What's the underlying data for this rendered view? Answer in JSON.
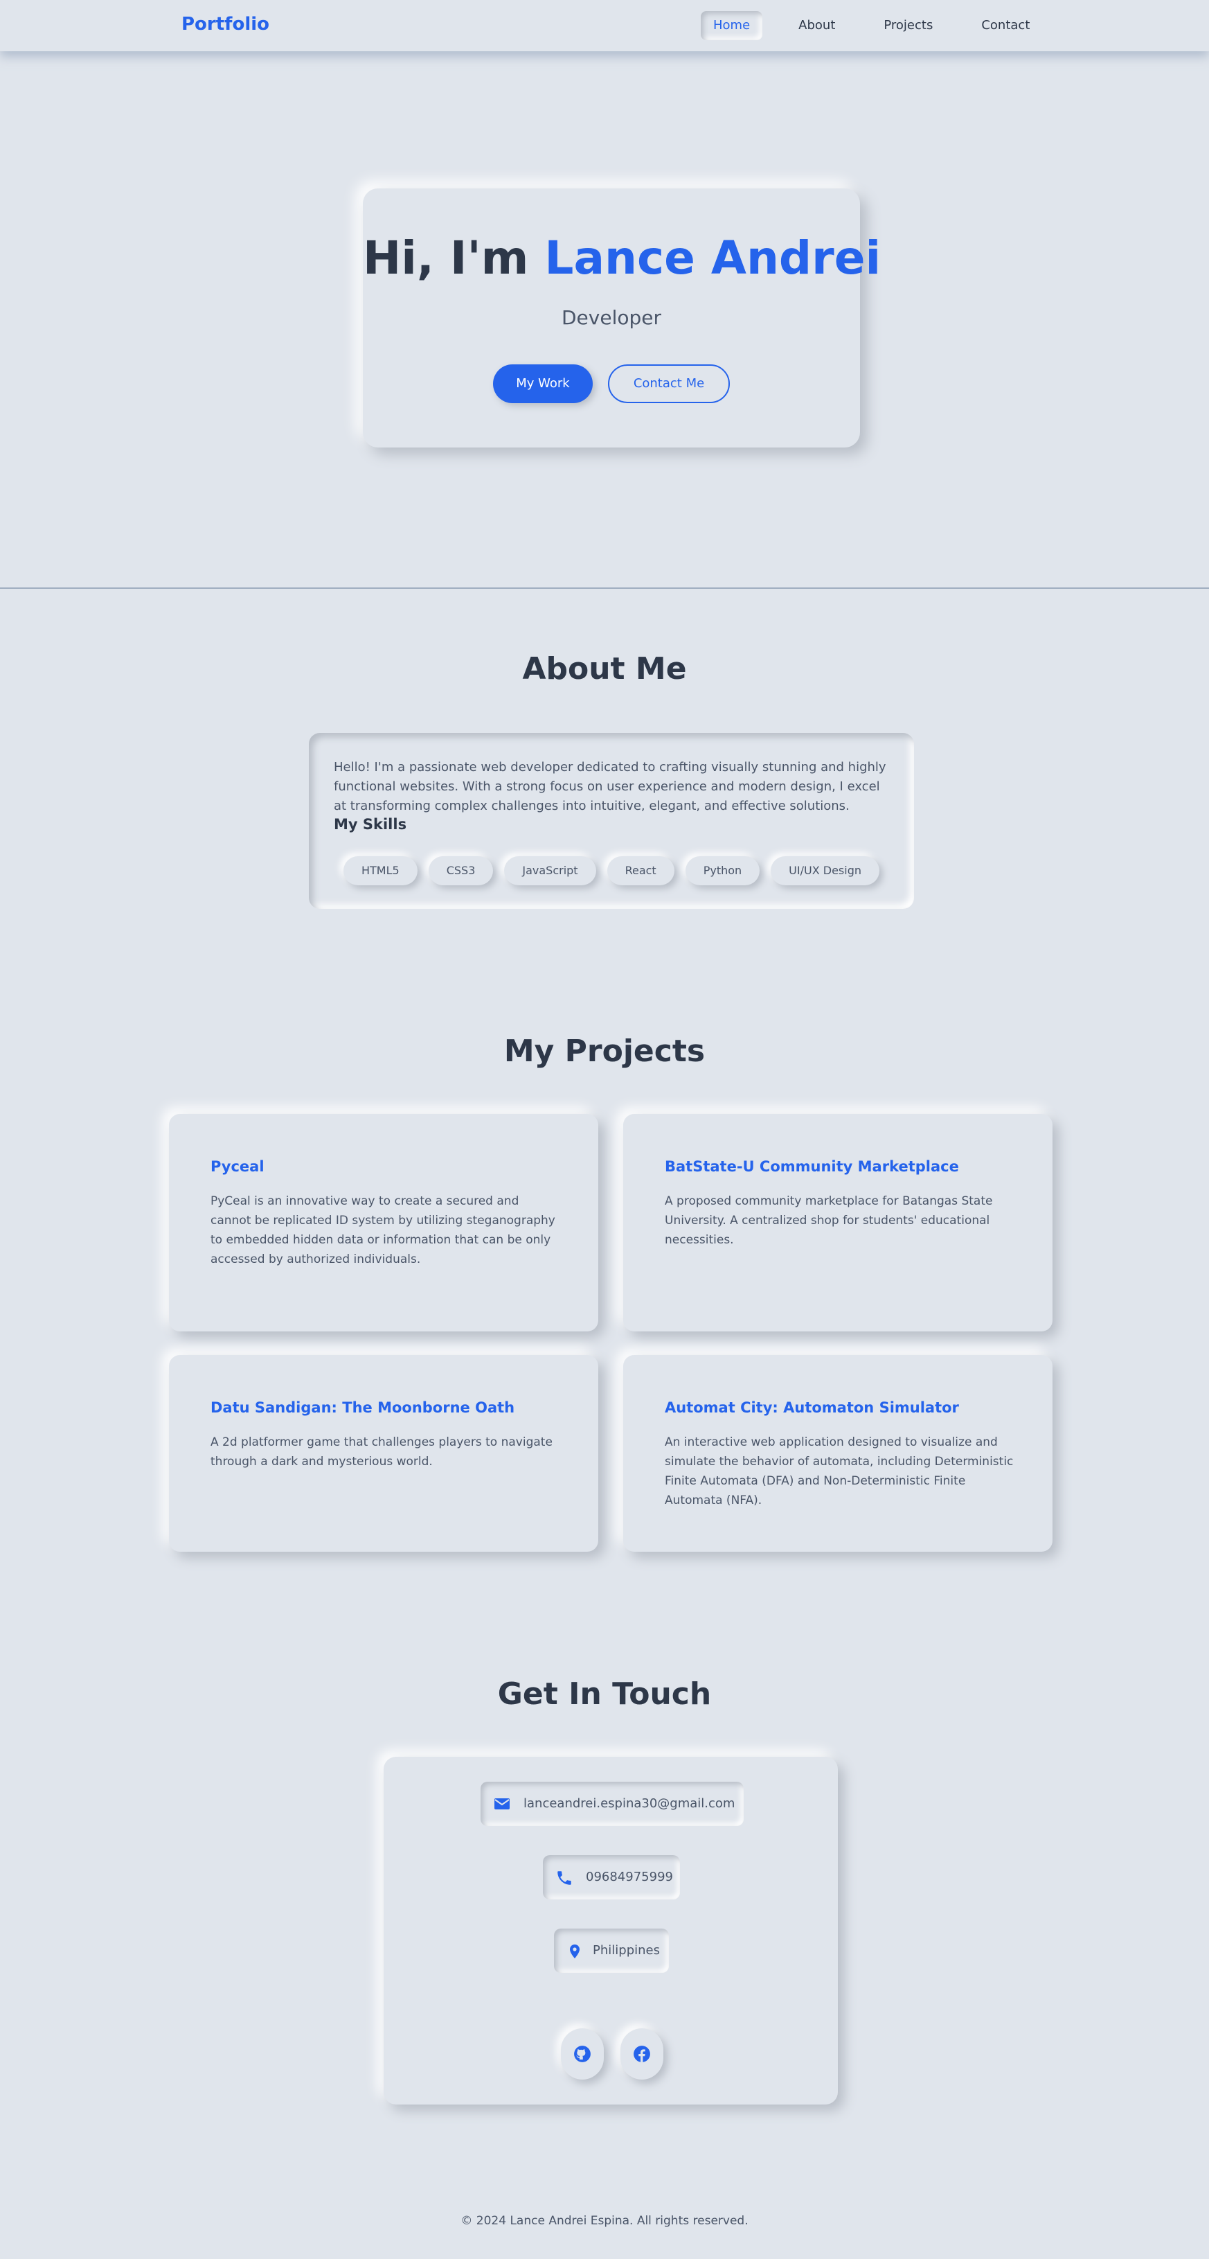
{
  "nav": {
    "logo": "Portfolio",
    "links": [
      {
        "label": "Home",
        "active": true
      },
      {
        "label": "About",
        "active": false
      },
      {
        "label": "Projects",
        "active": false
      },
      {
        "label": "Contact",
        "active": false
      }
    ]
  },
  "hero": {
    "greeting": "Hi, I'm ",
    "name": "Lance Andrei",
    "subtitle": "Developer",
    "primary_button": "My Work",
    "secondary_button": "Contact Me"
  },
  "about": {
    "title": "About Me",
    "text": "Hello! I'm a passionate web developer dedicated to crafting visually stunning and highly functional websites. With a strong focus on user experience and modern design, I excel at transforming complex challenges into intuitive, elegant, and effective solutions.",
    "skills_title": "My Skills",
    "skills": [
      "HTML5",
      "CSS3",
      "JavaScript",
      "React",
      "Python",
      "UI/UX Design"
    ]
  },
  "projects": {
    "title": "My Projects",
    "items": [
      {
        "title": "Pyceal",
        "description": "PyCeal is an innovative way to create a secured and cannot be replicated ID system by utilizing steganography to embedded hidden data or information that can be only accessed by authorized individuals."
      },
      {
        "title": "BatState-U Community Marketplace",
        "description": "A proposed community marketplace for Batangas State University. A centralized shop for students' educational necessities."
      },
      {
        "title": "Datu Sandigan: The Moonborne Oath",
        "description": "A 2d platformer game that challenges players to navigate through a dark and mysterious world."
      },
      {
        "title": "Automat City: Automaton Simulator",
        "description": "An interactive web application designed to visualize and simulate the behavior of automata, including Deterministic Finite Automata (DFA) and Non-Deterministic Finite Automata (NFA)."
      }
    ]
  },
  "contact": {
    "title": "Get In Touch",
    "email": "lanceandrei.espina30@gmail.com",
    "phone": "09684975999",
    "location": "Philippines",
    "socials": [
      {
        "icon": "github-icon"
      },
      {
        "icon": "facebook-icon"
      }
    ]
  },
  "footer": {
    "text": "© 2024 Lance Andrei Espina. All rights reserved."
  },
  "colors": {
    "background": "#e0e5ec",
    "accent": "#2563eb",
    "text": "#2d3748"
  }
}
